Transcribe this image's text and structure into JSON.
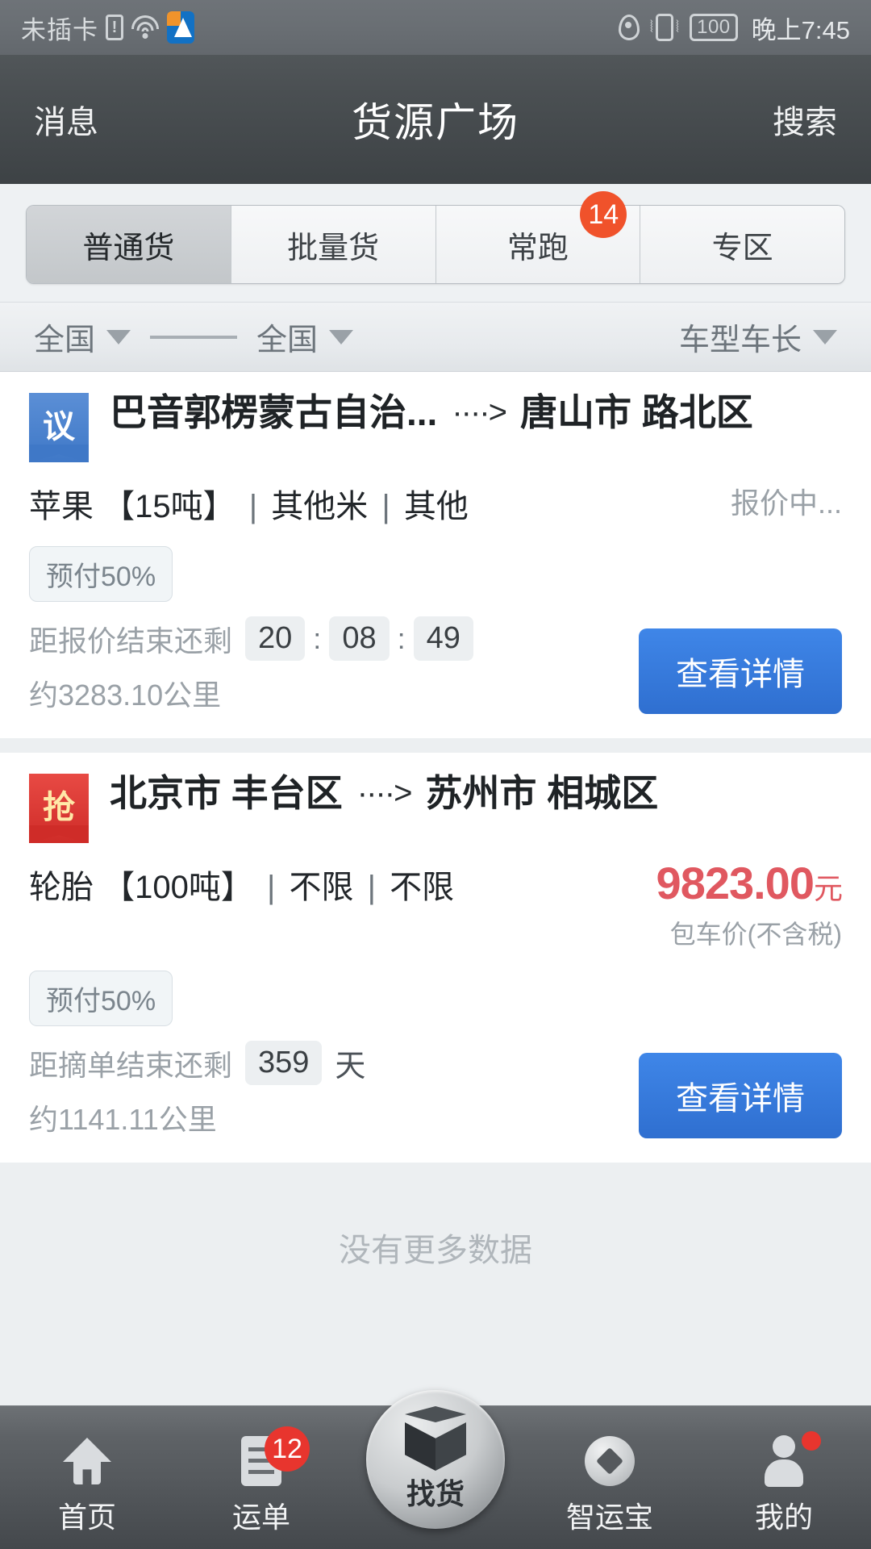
{
  "status_bar": {
    "carrier": "未插卡",
    "sim_icon": "sim-alert-icon",
    "wifi_icon": "wifi-icon",
    "app_icon": "app-notification-icon",
    "location_icon": "location-pin-icon",
    "vibrate_icon": "vibrate-icon",
    "battery_level": "100",
    "time": "晚上7:45"
  },
  "titlebar": {
    "left_button": "消息",
    "title": "货源广场",
    "right_button": "搜索"
  },
  "tabs": [
    {
      "label": "普通货",
      "active": true,
      "badge": ""
    },
    {
      "label": "批量货",
      "active": false,
      "badge": ""
    },
    {
      "label": "常跑",
      "active": false,
      "badge": "14"
    },
    {
      "label": "专区",
      "active": false,
      "badge": ""
    }
  ],
  "filters": {
    "origin": "全国",
    "destination": "全国",
    "vehicle": "车型车长",
    "caret_icon": "chevron-down-icon"
  },
  "cards": [
    {
      "badge_text": "议",
      "badge_type": "blue",
      "origin": "巴音郭楞蒙古自治...",
      "arrow_icon": "dashed-arrow-icon",
      "destination": "唐山市 路北区",
      "goods_name": "苹果",
      "goods_weight": "【15吨】",
      "goods_attr1": "其他米",
      "goods_attr2": "其他",
      "status_text": "报价中...",
      "prepay_tag": "预付50%",
      "countdown_label": "距报价结束还剩",
      "countdown_parts": [
        "20",
        "08",
        "49"
      ],
      "countdown_sep": ":",
      "countdown_unit": "",
      "distance": "约3283.10公里",
      "cta_label": "查看详情",
      "price": "",
      "price_unit": "",
      "price_note": ""
    },
    {
      "badge_text": "抢",
      "badge_type": "red",
      "origin": "北京市 丰台区",
      "arrow_icon": "dashed-arrow-icon",
      "destination": "苏州市 相城区",
      "goods_name": "轮胎",
      "goods_weight": "【100吨】",
      "goods_attr1": "不限",
      "goods_attr2": "不限",
      "status_text": "",
      "prepay_tag": "预付50%",
      "countdown_label": "距摘单结束还剩",
      "countdown_parts": [
        "359"
      ],
      "countdown_sep": "",
      "countdown_unit": "天",
      "distance": "约1141.11公里",
      "cta_label": "查看详情",
      "price": "9823.00",
      "price_unit": "元",
      "price_note": "包车价(不含税)"
    }
  ],
  "list_footer": "没有更多数据",
  "bottom_nav": [
    {
      "label": "首页",
      "icon": "home-icon",
      "badge": "",
      "dot": false,
      "center": false
    },
    {
      "label": "运单",
      "icon": "document-icon",
      "badge": "12",
      "dot": false,
      "center": false
    },
    {
      "label": "找货",
      "icon": "cube-icon",
      "badge": "",
      "dot": false,
      "center": true
    },
    {
      "label": "智运宝",
      "icon": "diamond-icon",
      "badge": "",
      "dot": false,
      "center": false
    },
    {
      "label": "我的",
      "icon": "person-icon",
      "badge": "",
      "dot": true,
      "center": false
    }
  ],
  "colors": {
    "accent_blue": "#3f86e8",
    "price_red": "#e05860",
    "badge_orange": "#f0522b",
    "badge_red": "#e8352e"
  }
}
